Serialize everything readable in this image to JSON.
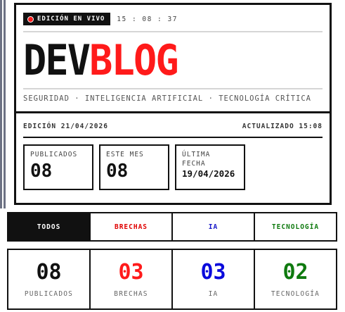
{
  "header": {
    "live_label": "EDICIÓN EN VIVO",
    "clock": "15 : 08 : 37",
    "logo_part1": "DEV",
    "logo_part2": "BLOG",
    "tagline": "SEGURIDAD · INTELIGENCIA ARTIFICIAL · TECNOLOGÍA CRÍTICA"
  },
  "edition": {
    "date_label": "EDICIÓN 21/04/2026",
    "updated_label": "ACTUALIZADO 15:08"
  },
  "stats": [
    {
      "label": "PUBLICADOS",
      "value": "08"
    },
    {
      "label": "ESTE MES",
      "value": "08"
    },
    {
      "label": "ÚLTIMA FECHA",
      "value": "19/04/2026"
    }
  ],
  "tabs": [
    {
      "label": "TODOS",
      "active": true,
      "color": "#ffffff"
    },
    {
      "label": "BRECHAS",
      "active": false,
      "color": "#e00000"
    },
    {
      "label": "IA",
      "active": false,
      "color": "#1414c8"
    },
    {
      "label": "TECNOLOGÍA",
      "active": false,
      "color": "#0f7a0f"
    }
  ],
  "counters": [
    {
      "value": "08",
      "caption": "PUBLICADOS",
      "color": "#111111"
    },
    {
      "value": "03",
      "caption": "BRECHAS",
      "color": "#ff1a1a"
    },
    {
      "value": "03",
      "caption": "IA",
      "color": "#0a0adc"
    },
    {
      "value": "02",
      "caption": "TECNOLOGÍA",
      "color": "#0f7a0f"
    }
  ],
  "colors": {
    "accent_red": "#ff1a1a",
    "ink": "#111111"
  }
}
